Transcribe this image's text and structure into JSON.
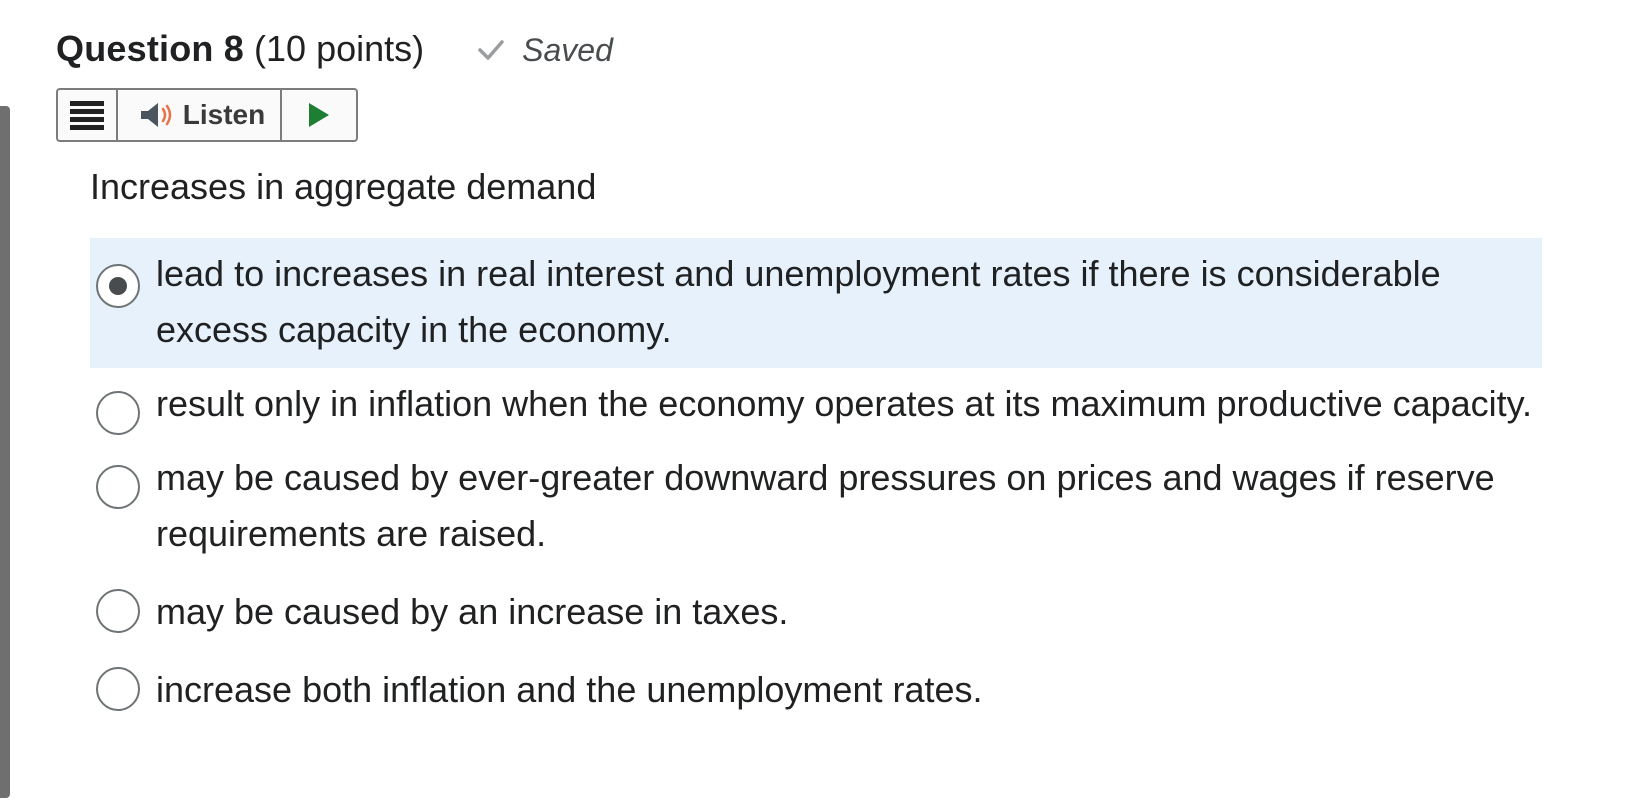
{
  "question": {
    "title": "Question 8",
    "points": "(10 points)",
    "status": "Saved",
    "status_icon": "checkmark-icon"
  },
  "toolbar": {
    "menu_icon": "hamburger-menu-icon",
    "listen_label": "Listen",
    "listen_icon": "speaker-icon",
    "play_icon": "play-icon",
    "play_color": "#1e7e34"
  },
  "prompt": "Increases in aggregate demand",
  "options": [
    {
      "text": "lead to increases in real interest and unemployment rates if there is considerable excess capacity in the economy.",
      "selected": true
    },
    {
      "text": "result only in inflation when the economy operates at its maximum productive capacity.",
      "selected": false
    },
    {
      "text": "may be caused by ever-greater downward pressures on prices and wages if reserve requirements are raised.",
      "selected": false
    },
    {
      "text": "may be caused by an increase in taxes.",
      "selected": false
    },
    {
      "text": "increase both inflation and the unemployment rates.",
      "selected": false
    }
  ],
  "colors": {
    "selected_background": "#e6f1fc",
    "speaker_wave": "#e8734a"
  }
}
